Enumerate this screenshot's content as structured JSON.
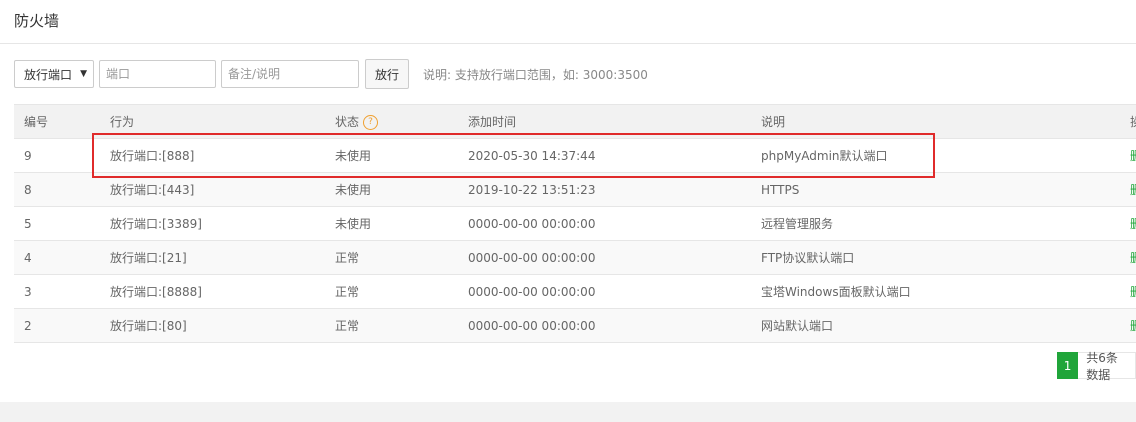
{
  "page": {
    "title": "防火墙"
  },
  "toolbar": {
    "action_select": "放行端口",
    "port_placeholder": "端口",
    "note_placeholder": "备注/说明",
    "submit_label": "放行",
    "hint": "说明: 支持放行端口范围，如: 3000:3500"
  },
  "table": {
    "headers": {
      "id": "编号",
      "action": "行为",
      "status": "状态",
      "time": "添加时间",
      "desc": "说明",
      "op": "操"
    },
    "rows": [
      {
        "id": "9",
        "action": "放行端口:[888]",
        "status": "未使用",
        "time": "2020-05-30 14:37:44",
        "desc": "phpMyAdmin默认端口",
        "op": "删"
      },
      {
        "id": "8",
        "action": "放行端口:[443]",
        "status": "未使用",
        "time": "2019-10-22 13:51:23",
        "desc": "HTTPS",
        "op": "删"
      },
      {
        "id": "5",
        "action": "放行端口:[3389]",
        "status": "未使用",
        "time": "0000-00-00 00:00:00",
        "desc": "远程管理服务",
        "op": "删"
      },
      {
        "id": "4",
        "action": "放行端口:[21]",
        "status": "正常",
        "time": "0000-00-00 00:00:00",
        "desc": "FTP协议默认端口",
        "op": "删"
      },
      {
        "id": "3",
        "action": "放行端口:[8888]",
        "status": "正常",
        "time": "0000-00-00 00:00:00",
        "desc": "宝塔Windows面板默认端口",
        "op": "删"
      },
      {
        "id": "2",
        "action": "放行端口:[80]",
        "status": "正常",
        "time": "0000-00-00 00:00:00",
        "desc": "网站默认端口",
        "op": "删"
      }
    ]
  },
  "pagination": {
    "current": "1",
    "total_text": "共6条数据"
  },
  "colors": {
    "accent": "#20a53a",
    "highlight": "#e02b2b",
    "help": "#f0a030"
  },
  "icons": {
    "select_arrow": "caret-down-icon",
    "help": "question-circle-icon"
  }
}
